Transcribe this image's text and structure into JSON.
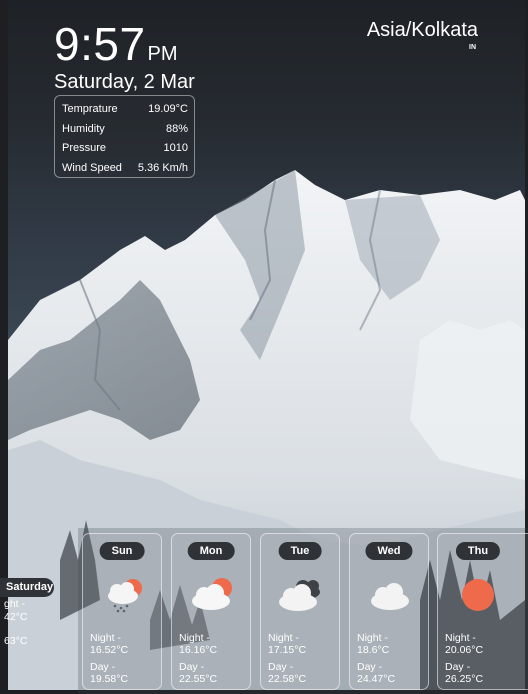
{
  "clock": {
    "time": "9:57",
    "ampm": "PM",
    "date": "Saturday, 2 Mar"
  },
  "location": {
    "timezone": "Asia/Kolkata",
    "country": "IN"
  },
  "stats": [
    {
      "label": "Temprature",
      "value": "19.09°C"
    },
    {
      "label": "Humidity",
      "value": "88%"
    },
    {
      "label": "Pressure",
      "value": "1010"
    },
    {
      "label": "Wind Speed",
      "value": "5.36 Km/h"
    }
  ],
  "today": {
    "day": "Saturday",
    "night": "ght -\n42°C",
    "day_temp": "63°C"
  },
  "forecast": [
    {
      "day": "Sun",
      "icon": "rain-cloud-sun-icon",
      "night": "Night -\n16.52°C",
      "day_temp": "Day -\n19.58°C"
    },
    {
      "day": "Mon",
      "icon": "cloud-sun-icon",
      "night": "Night -\n16.16°C",
      "day_temp": "Day -\n22.55°C"
    },
    {
      "day": "Tue",
      "icon": "dark-clouds-icon",
      "night": "Night -\n17.15°C",
      "day_temp": "Day -\n22.58°C"
    },
    {
      "day": "Wed",
      "icon": "cloud-icon",
      "night": "Night -\n18.6°C",
      "day_temp": "Day -\n24.47°C"
    },
    {
      "day": "Thu",
      "icon": "sun-icon",
      "night": "Night -\n20.06°C",
      "day_temp": "Day -\n26.25°C"
    }
  ]
}
